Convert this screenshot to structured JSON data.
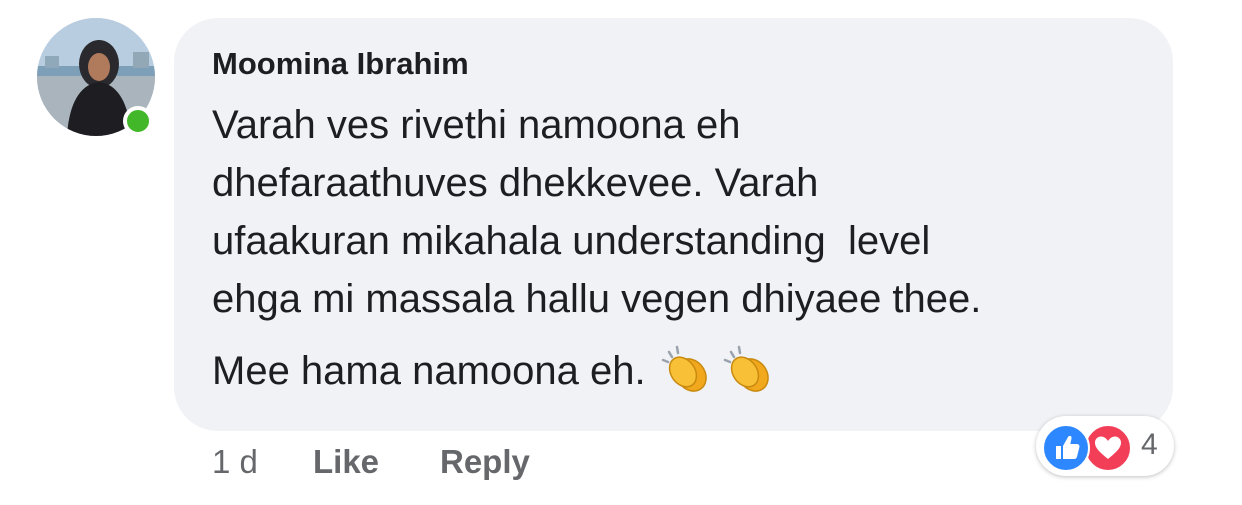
{
  "comment": {
    "author": "Moomina Ibrahim",
    "avatar_icon": "profile-photo",
    "online_status_color": "#42b72a",
    "body_lines": [
      "Varah ves rivethi namoona eh",
      "dhefaraathuves dhekkevee. Varah",
      "ufaakuran mikahala understanding  level",
      "ehga mi massala hallu vegen dhiyaee thee."
    ],
    "last_line": "Mee hama namoona eh.",
    "emoji": [
      "clapping-hands",
      "clapping-hands"
    ]
  },
  "actions": {
    "time": "1 d",
    "like_label": "Like",
    "reply_label": "Reply"
  },
  "reactions": {
    "types": [
      "like-icon",
      "love-icon"
    ],
    "count": "4",
    "like_color": "#2d88ff",
    "love_color": "#f33e58"
  }
}
